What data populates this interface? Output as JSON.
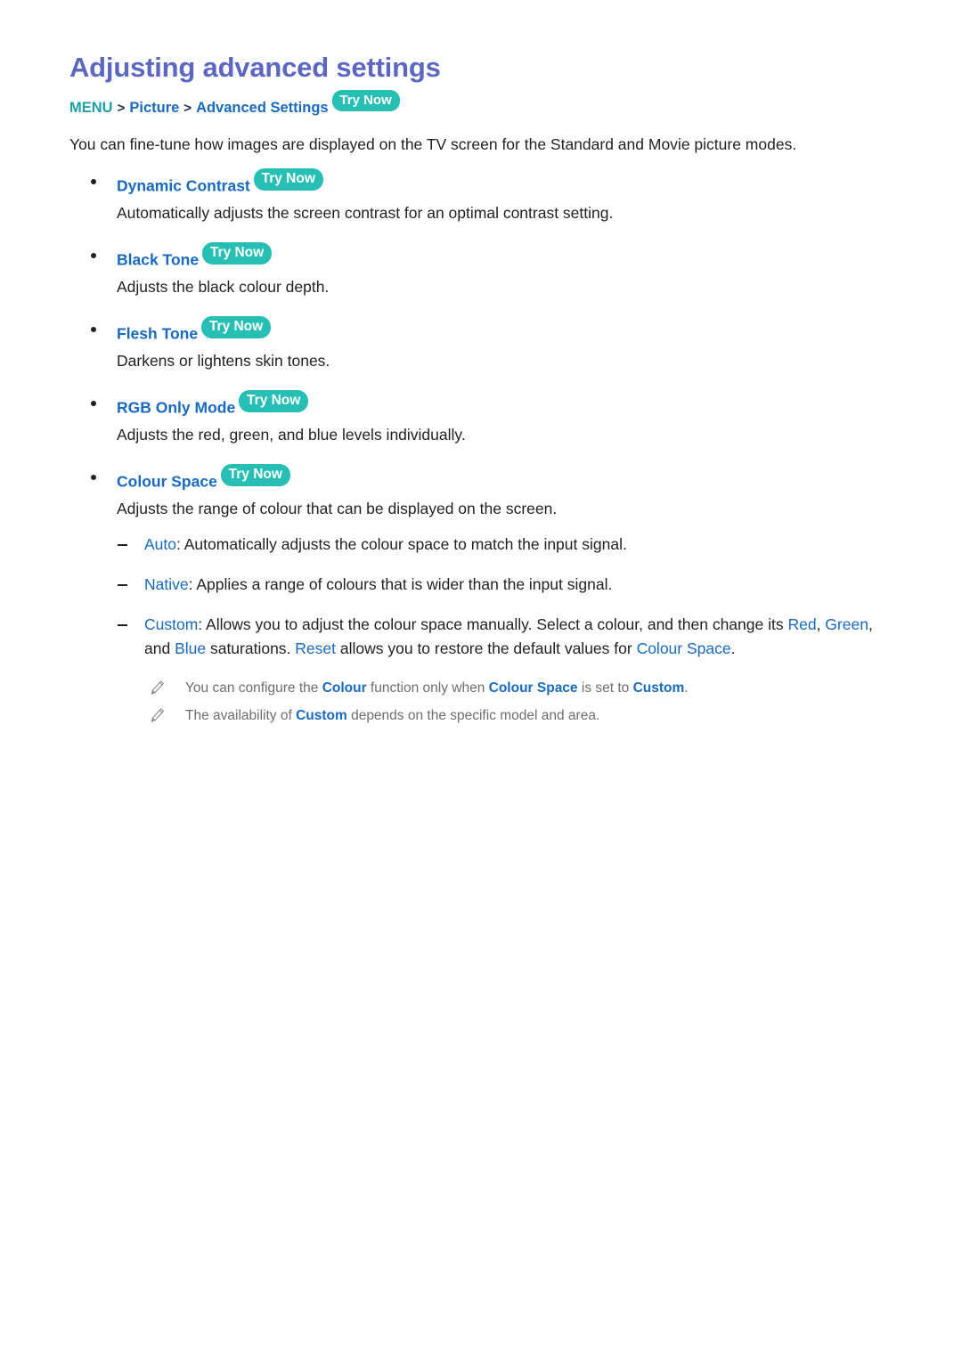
{
  "title": "Adjusting advanced settings",
  "breadcrumb": {
    "menu": "MENU",
    "separator": ">",
    "item1": "Picture",
    "item2": "Advanced Settings",
    "try_now": "Try Now"
  },
  "intro": "You can fine-tune how images are displayed on the TV screen for the Standard and Movie picture modes.",
  "settings": [
    {
      "label": "Dynamic Contrast",
      "try_now": "Try Now",
      "description": "Automatically adjusts the screen contrast for an optimal contrast setting."
    },
    {
      "label": "Black Tone",
      "try_now": "Try Now",
      "description": "Adjusts the black colour depth."
    },
    {
      "label": "Flesh Tone",
      "try_now": "Try Now",
      "description": "Darkens or lightens skin tones."
    },
    {
      "label": "RGB Only Mode",
      "try_now": "Try Now",
      "description": "Adjusts the red, green, and blue levels individually."
    },
    {
      "label": "Colour Space",
      "try_now": "Try Now",
      "description": "Adjusts the range of colour that can be displayed on the screen."
    }
  ],
  "colour_space_options": {
    "auto": {
      "term": "Auto",
      "text": ": Automatically adjusts the colour space to match the input signal."
    },
    "native": {
      "term": "Native",
      "text": ": Applies a range of colours that is wider than the input signal."
    },
    "custom": {
      "term": "Custom",
      "part1": ": Allows you to adjust the colour space manually. Select a colour, and then change its ",
      "red": "Red",
      "comma1": ", ",
      "green": "Green",
      "part2": ", and ",
      "blue": "Blue",
      "part3": " saturations. ",
      "reset": "Reset",
      "part4": " allows you to restore the default values for ",
      "colour_space": "Colour Space",
      "period": "."
    }
  },
  "notes": [
    {
      "icon": "pencil-icon",
      "part1": "You can configure the ",
      "kw1": "Colour",
      "part2": " function only when ",
      "kw2": "Colour Space",
      "part3": " is set to ",
      "kw3": "Custom",
      "part4": "."
    },
    {
      "icon": "pencil-icon",
      "part1": "The availability of ",
      "kw1": "Custom",
      "part2": " depends on the specific model and area.",
      "kw2": "",
      "part3": "",
      "kw3": "",
      "part4": ""
    }
  ],
  "colors": {
    "title": "#5b67c0",
    "accent_blue": "#1869c0",
    "teal": "#27bfb4",
    "menu_teal": "#1d9fa8",
    "body_text": "#231f20",
    "note_text": "#6d6e71"
  }
}
